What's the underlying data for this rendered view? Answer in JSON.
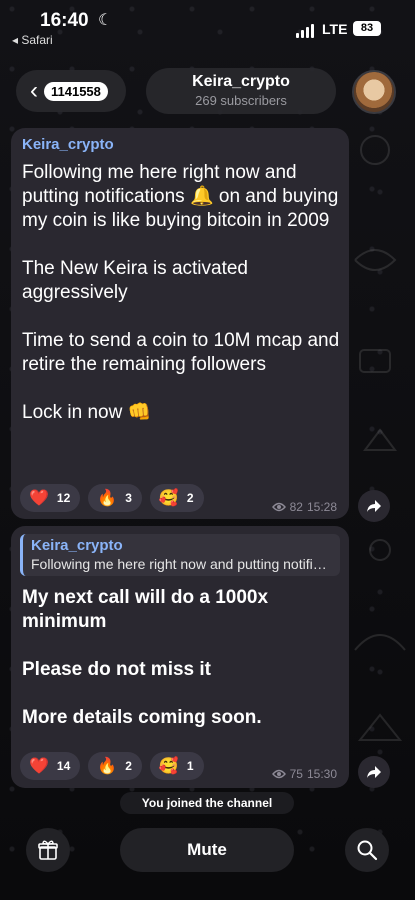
{
  "status": {
    "time": "16:40",
    "back_app": "◂ Safari",
    "network": "LTE",
    "battery": "83"
  },
  "header": {
    "back_count": "1141558",
    "channel_name": "Keira_crypto",
    "subscribers": "269 subscribers"
  },
  "messages": [
    {
      "author": "Keira_crypto",
      "text": "Following me here right now and putting notifications 🔔 on and buying my coin is like buying bitcoin in 2009\n\nThe New Keira is activated aggressively\n\nTime to send a coin to 10M mcap and retire the remaining followers\n\nLock in now 👊",
      "reactions": [
        {
          "emoji": "❤️",
          "count": "12"
        },
        {
          "emoji": "🔥",
          "count": "3"
        },
        {
          "emoji": "🥰",
          "count": "2"
        }
      ],
      "views": "82",
      "time": "15:28"
    },
    {
      "quote_author": "Keira_crypto",
      "quote_text": "Following me here right now and putting notifications on and buying my coin",
      "text": "My next call will do a 1000x minimum\n\nPlease do not miss it\n\nMore details coming soon.",
      "reactions": [
        {
          "emoji": "❤️",
          "count": "14"
        },
        {
          "emoji": "🔥",
          "count": "2"
        },
        {
          "emoji": "🥰",
          "count": "1"
        }
      ],
      "views": "75",
      "time": "15:30"
    }
  ],
  "service_message": "You joined the channel",
  "bottom": {
    "mute_label": "Mute"
  },
  "colors": {
    "accent": "#8ab4f8",
    "bubble": "#2a2830",
    "background": "#0b0b0d"
  },
  "icons": [
    "back-chevron-icon",
    "bell-icon",
    "fist-icon",
    "eye-icon",
    "share-icon",
    "gift-icon",
    "search-icon"
  ]
}
